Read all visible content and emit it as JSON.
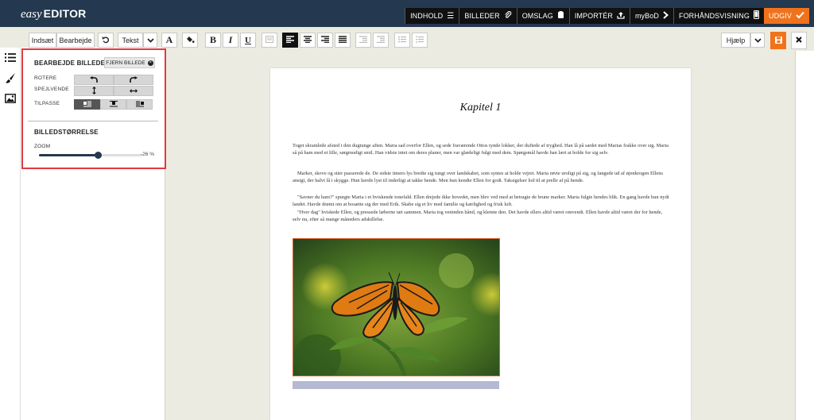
{
  "app": {
    "logo_prefix": "easy",
    "logo_name": "EDITOR"
  },
  "nav": [
    {
      "label": "INDHOLD",
      "icon": "list-icon"
    },
    {
      "label": "BILLEDER",
      "icon": "paperclip-icon"
    },
    {
      "label": "OMSLAG",
      "icon": "book-cover-icon"
    },
    {
      "label": "IMPORTÉR",
      "icon": "upload-icon"
    },
    {
      "label": "myBoD",
      "icon": "chevron-right-icon"
    },
    {
      "label": "FORHÅNDSVISNING",
      "icon": "phone-icon"
    },
    {
      "label": "UDGIV",
      "icon": "check-icon"
    }
  ],
  "toolbar": {
    "insert_label": "Indsæt",
    "edit_label": "Bearbejde",
    "style_label": "Tekst",
    "help_label": "Hjælp"
  },
  "edit_panel": {
    "title": "BEARBEJDE BILLEDE",
    "remove_label": "FJERN BILLEDE",
    "rotate_label": "ROTERE",
    "mirror_label": "SPEJLVENDE",
    "fit_label": "TILPASSE",
    "size_title": "BILLEDSTØRRELSE",
    "zoom_label": "ZOOM",
    "zoom_value": "-26 %",
    "zoom_fraction": 0.57
  },
  "document": {
    "chapter_title": "Kapitel 1",
    "paragraphs": [
      "Toget skramlede afsted i den dugtunge aften. Maria sad overfor Ellen, og sede fraværende Ottos tynde lokker, der duftede af tryghed. Han lå på sædet med Marias frakke over sig. Maria så på ham med et lille, sørgmodigt smil. Han vidste intet om deres planer, men var glædeligt fulgt med dem. Spørgsmål havde han lært at holde for sig selv.",
      "Marker, skove og stier passerede de. De sidste timers lys bredte sig tungt over landskabet, som syntes at holde vejret. Maria røvte uroligt på sig, og fangede ud af øjenkrogen Ellens ansigt, der halvt lå i skygge. Hun havde lyst til inderligt at takke hende. Men hun kendte Ellen for godt. Taksigelser lod til at prelle af på hende.",
      "\"Savner du ham?\" spurgte Maria i et hviskende tonefald. Ellen drejede ikke hovedet, men blev ved med at betragte de brune marker. Maria fulgte hendes blik. En gang havde hun nydt landet. Havde drømt om at bosætte sig der med Erik. Skabe sig et liv med familie og kærlighed og frisk luft.",
      "\"Hver dag\" hviskede Ellen, og pressede læberne tæt sammen. Maria tog veninden hånd, og klemte den. Det havde ellers altid været omvendt. Ellen havde altid været der for hende, selv nu, efter så mange måneders adskillelse."
    ]
  },
  "colors": {
    "topbar": "#24394f",
    "accent": "#f0731c",
    "highlight_border": "#e03a3e",
    "workspace": "#ecebe1"
  }
}
